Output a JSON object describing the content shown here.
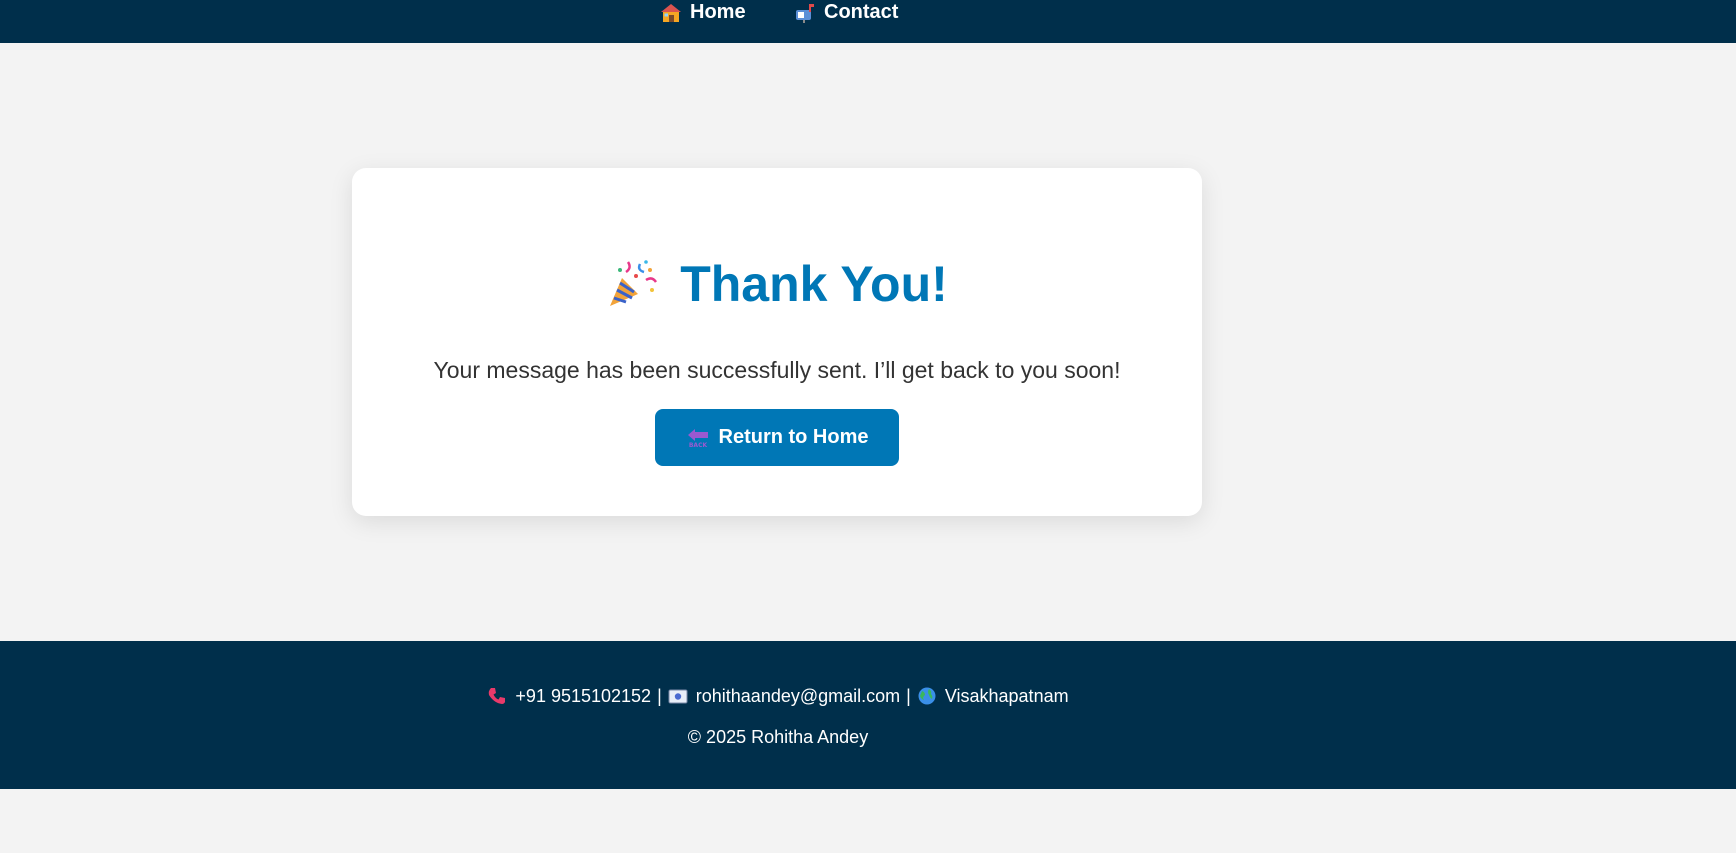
{
  "nav": {
    "home_label": "Home",
    "contact_label": "Contact",
    "home_icon": "house-icon",
    "contact_icon": "mailbox-icon"
  },
  "card": {
    "title": "Thank You!",
    "title_icon": "party-popper-icon",
    "message": "Your message has been successfully sent. I’ll get back to you soon!",
    "button_label": "Return to Home",
    "button_icon": "back-arrow-icon"
  },
  "footer": {
    "phone": "+91 9515102152",
    "email": "rohithaandey@gmail.com",
    "location": "Visakhapatnam",
    "separator": "|",
    "copyright": "© 2025 Rohitha Andey",
    "phone_icon": "phone-icon",
    "email_icon": "envelope-icon",
    "location_icon": "globe-icon"
  },
  "colors": {
    "nav_bg": "#002f4b",
    "page_bg": "#f3f3f3",
    "accent": "#0077b6",
    "card_bg": "#ffffff"
  }
}
